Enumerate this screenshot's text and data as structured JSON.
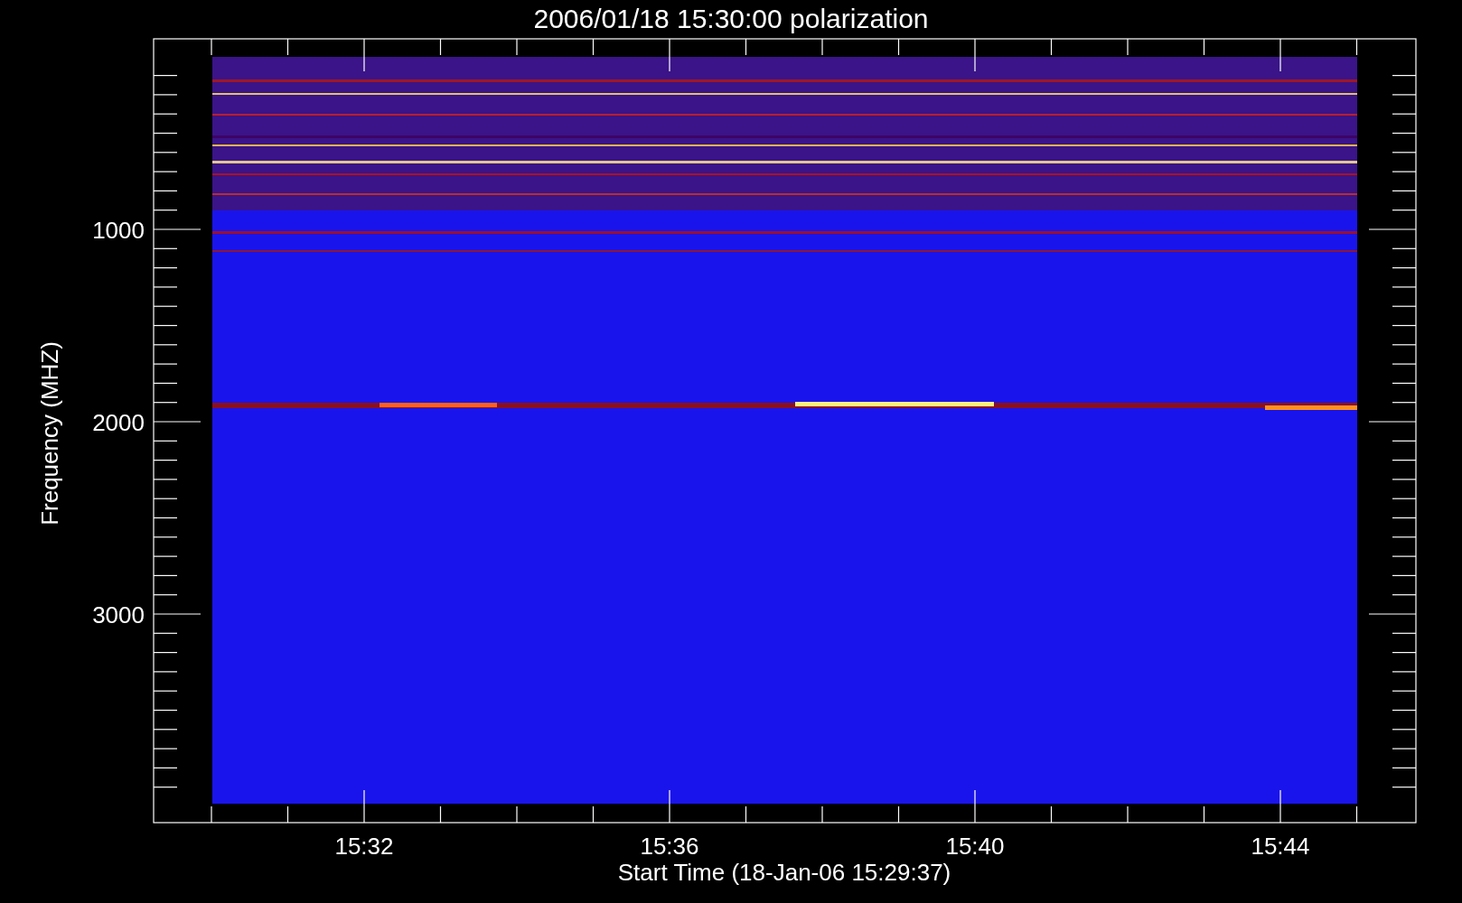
{
  "title": "2006/01/18 15:30:00 polarization",
  "y_axis": {
    "label": "Frequency (MHZ)",
    "ticks": [
      "1000",
      "2000",
      "3000"
    ]
  },
  "x_axis": {
    "label": "Start Time (18-Jan-06 15:29:37)",
    "ticks": [
      "15:32",
      "15:36",
      "15:40",
      "15:44"
    ]
  }
}
